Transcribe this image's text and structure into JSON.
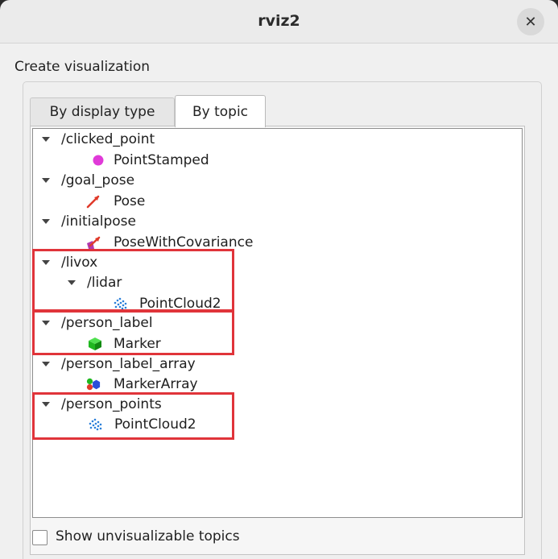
{
  "window": {
    "title": "rviz2"
  },
  "section": {
    "label": "Create visualization"
  },
  "tabs": [
    {
      "label": "By display type",
      "active": false
    },
    {
      "label": "By topic",
      "active": true
    }
  ],
  "tree": {
    "rows": [
      {
        "label": "/clicked_point",
        "kind": "topic"
      },
      {
        "label": "PointStamped",
        "kind": "display",
        "icon": "point-stamped-icon"
      },
      {
        "label": "/goal_pose",
        "kind": "topic"
      },
      {
        "label": "Pose",
        "kind": "display",
        "icon": "pose-arrow-icon"
      },
      {
        "label": "/initialpose",
        "kind": "topic"
      },
      {
        "label": "PoseWithCovariance",
        "kind": "display",
        "icon": "pose-covariance-icon"
      },
      {
        "label": "/livox",
        "kind": "topic"
      },
      {
        "label": "/lidar",
        "kind": "topic"
      },
      {
        "label": "PointCloud2",
        "kind": "display",
        "icon": "pointcloud-icon"
      },
      {
        "label": "/person_label",
        "kind": "topic"
      },
      {
        "label": "Marker",
        "kind": "display",
        "icon": "marker-cube-icon"
      },
      {
        "label": "/person_label_array",
        "kind": "topic"
      },
      {
        "label": "MarkerArray",
        "kind": "display",
        "icon": "marker-array-icon"
      },
      {
        "label": "/person_points",
        "kind": "topic"
      },
      {
        "label": "PointCloud2",
        "kind": "display",
        "icon": "pointcloud-icon"
      }
    ]
  },
  "options": {
    "show_unvisualizable_label": "Show unvisualizable topics",
    "show_unvisualizable_checked": false
  },
  "colors": {
    "highlight": "#e0343a",
    "point_stamped": "#e03ad8",
    "pose_arrow": "#e03a2a",
    "marker": "#1fb81f",
    "pointcloud": "#2a7fd9"
  }
}
